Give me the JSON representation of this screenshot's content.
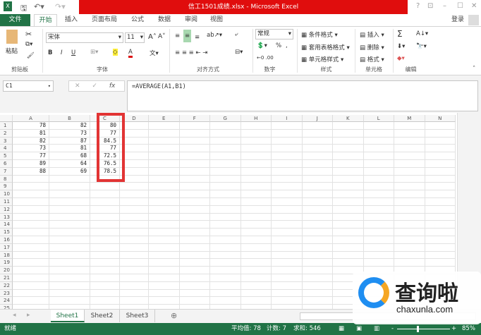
{
  "title": "信工1501成绩.xlsx - Microsoft Excel",
  "quick_access": {
    "save": "save-icon",
    "undo": "undo-icon",
    "redo": "redo-icon"
  },
  "window_controls": [
    "?",
    "⊡",
    "–",
    "☐",
    "✕"
  ],
  "tabs": [
    "文件",
    "开始",
    "插入",
    "页面布局",
    "公式",
    "数据",
    "审阅",
    "视图"
  ],
  "login": "登录",
  "ribbon": {
    "clipboard": {
      "paste": "粘贴",
      "group": "剪贴板"
    },
    "font": {
      "name": "宋体",
      "size": "11",
      "bold": "B",
      "italic": "I",
      "underline": "U",
      "group": "字体"
    },
    "alignment": {
      "group": "对齐方式"
    },
    "number": {
      "format": "常规",
      "percent": "%",
      "comma": ",",
      "group": "数字"
    },
    "styles": {
      "conditional": "条件格式",
      "table": "套用表格格式",
      "cell": "单元格样式",
      "group": "样式"
    },
    "cells": {
      "insert": "插入",
      "delete": "删除",
      "format": "格式",
      "group": "单元格"
    },
    "editing": {
      "sum": "Σ",
      "group": "编辑"
    }
  },
  "formula_bar": {
    "name_box": "C1",
    "cancel": "✕",
    "enter": "✓",
    "fx": "fx",
    "formula": "=AVERAGE(A1,B1)"
  },
  "columns": [
    "A",
    "B",
    "C",
    "D",
    "E",
    "F",
    "G",
    "H",
    "I",
    "J",
    "K",
    "L",
    "M",
    "N"
  ],
  "rows": [
    [
      "78",
      "82",
      "80"
    ],
    [
      "81",
      "73",
      "77"
    ],
    [
      "82",
      "87",
      "84.5"
    ],
    [
      "73",
      "81",
      "77"
    ],
    [
      "77",
      "68",
      "72.5"
    ],
    [
      "89",
      "64",
      "76.5"
    ],
    [
      "88",
      "69",
      "78.5"
    ]
  ],
  "row_count": 25,
  "sheets": [
    "Sheet1",
    "Sheet2",
    "Sheet3"
  ],
  "active_sheet": "Sheet1",
  "status": {
    "ready": "就绪",
    "average": "平均值: 78",
    "count": "计数: 7",
    "sum": "求和: 546",
    "zoom": "85%"
  },
  "watermark": {
    "text": "查询啦",
    "url": "chaxunla.com"
  },
  "colors": {
    "excel_green": "#217346",
    "title_red": "#e00d0d",
    "highlight": "#e23434"
  }
}
